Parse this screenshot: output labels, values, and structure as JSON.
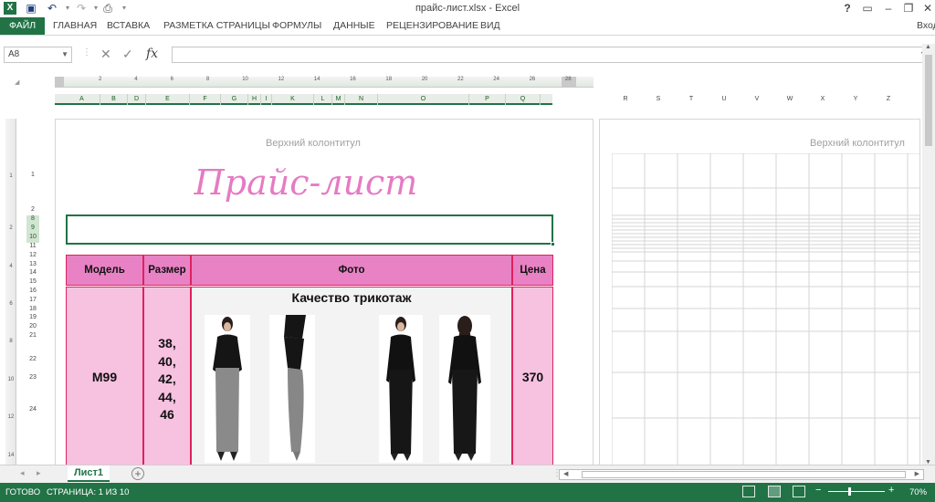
{
  "window": {
    "title": "прайс-лист.xlsx - Excel",
    "help": "?",
    "signin": "Вход"
  },
  "ribbon": {
    "tabs": [
      "ФАЙЛ",
      "ГЛАВНАЯ",
      "ВСТАВКА",
      "РАЗМЕТКА СТРАНИЦЫ",
      "ФОРМУЛЫ",
      "ДАННЫЕ",
      "РЕЦЕНЗИРОВАНИЕ",
      "ВИД"
    ]
  },
  "formula_bar": {
    "name_box": "A8",
    "fx": "fx",
    "formula": ""
  },
  "ruler": {
    "ticks": [
      "2",
      "4",
      "6",
      "8",
      "10",
      "12",
      "14",
      "16",
      "18",
      "20",
      "22",
      "24",
      "26",
      "28"
    ]
  },
  "columns": {
    "page1": [
      "A",
      "B",
      "D",
      "E",
      "F",
      "G",
      "H",
      "I",
      "K",
      "L",
      "M",
      "N",
      "O",
      "P",
      "Q"
    ],
    "page2": [
      "R",
      "S",
      "T",
      "U",
      "V",
      "W",
      "X",
      "Y",
      "Z"
    ]
  },
  "vruler": {
    "ticks": [
      "1",
      "2",
      "4",
      "6",
      "8",
      "10",
      "12",
      "14"
    ]
  },
  "rows": [
    "1",
    "2",
    "8",
    "9",
    "10",
    "11",
    "12",
    "13",
    "14",
    "15",
    "16",
    "17",
    "18",
    "19",
    "20",
    "21",
    "22",
    "23",
    "24"
  ],
  "page": {
    "header_placeholder": "Верхний колонтитул",
    "header_placeholder_2": "Верхний колонтитул",
    "price_title": "Прайс-лист",
    "table": {
      "headers": {
        "model": "Модель",
        "size": "Размер",
        "photo": "Фото",
        "price": "Цена"
      },
      "row": {
        "model": "M99",
        "sizes": [
          "38,",
          "40,",
          "42,",
          "44,",
          "46"
        ],
        "quality": "Качество трикотаж",
        "price": "370"
      }
    }
  },
  "sheets": {
    "tabs": [
      "Лист1"
    ],
    "add": "+"
  },
  "status": {
    "ready": "ГОТОВО",
    "page": "СТРАНИЦА: 1 ИЗ 10",
    "zoom": "70%",
    "minus": "−",
    "plus": "+"
  },
  "colors": {
    "excel_green": "#217346",
    "title_pink": "#e57bc3",
    "header_fill": "#e882c4",
    "body_fill": "#f7c1e0",
    "border_red": "#e0215e"
  }
}
